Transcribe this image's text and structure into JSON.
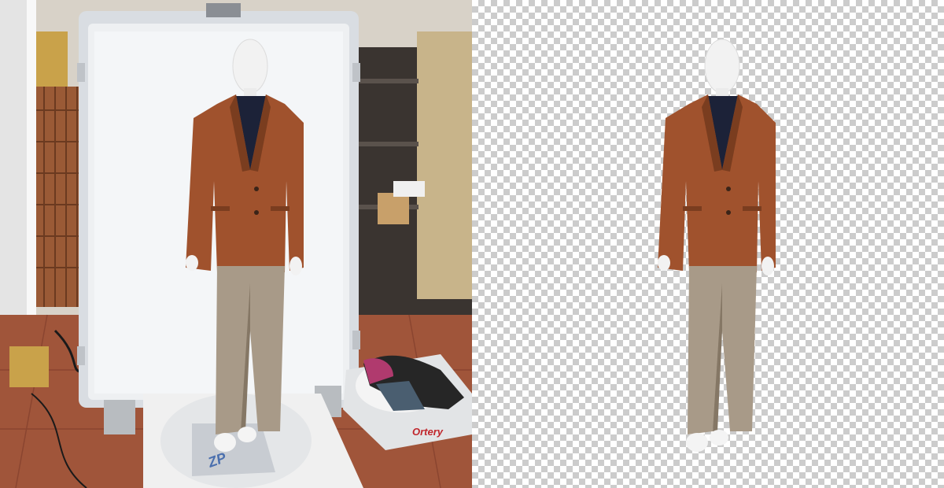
{
  "panels": {
    "original": {
      "platform_brand": "Ortery"
    },
    "cutout": {}
  },
  "colors": {
    "jacket": "#a0522d",
    "jacket_shadow": "#7a3d1f",
    "sweater": "#1c2238",
    "trousers": "#a89a88",
    "trousers_shadow": "#857765",
    "mannequin": "#f2f2f2",
    "floor_tile": "#a0553a",
    "lightbox_panel": "#eef0f2",
    "checker_light": "#ffffff",
    "checker_dark": "#cccccc"
  }
}
